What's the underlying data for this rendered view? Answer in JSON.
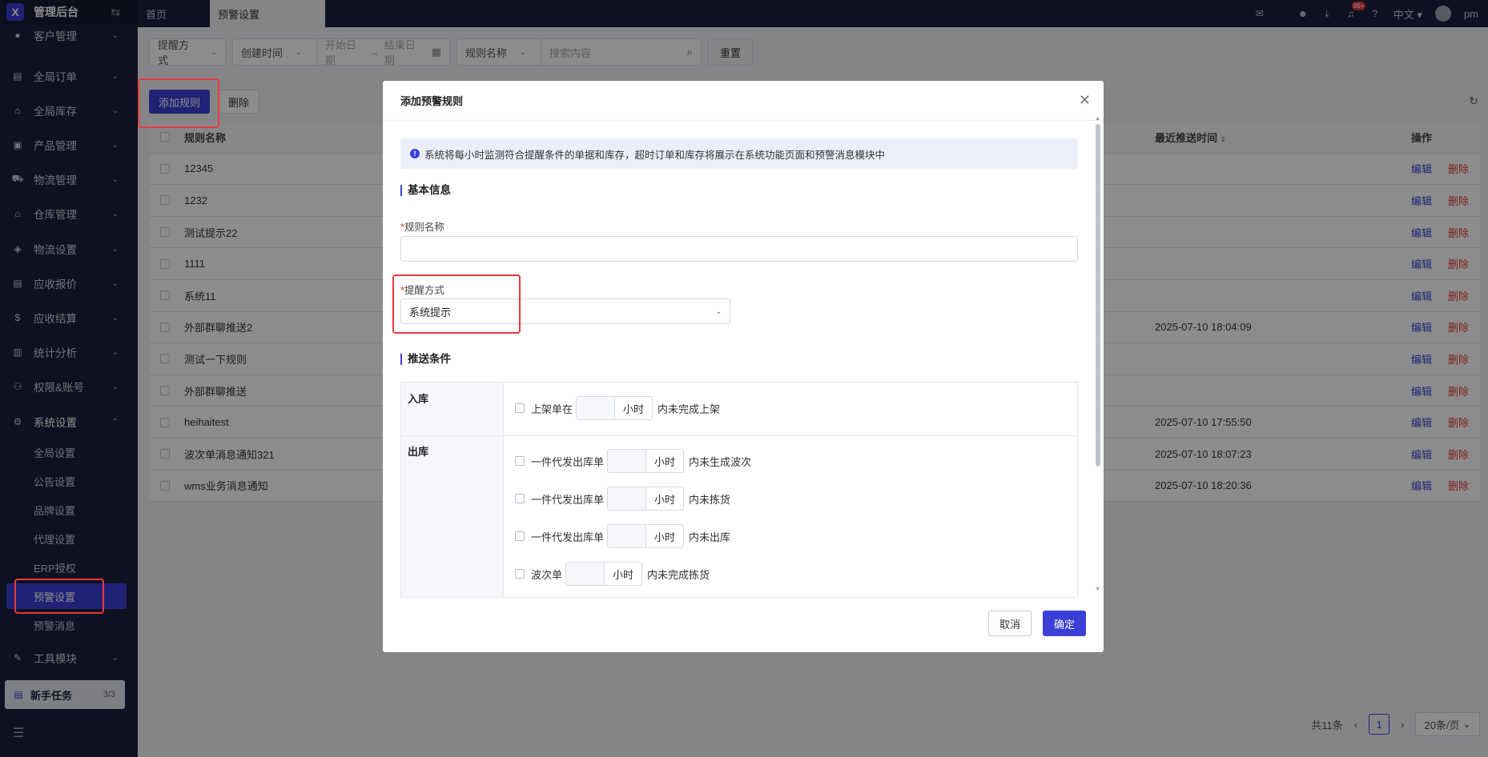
{
  "app": {
    "title": "管理后台",
    "logo": "X"
  },
  "topbar": {
    "tabs": [
      {
        "label": "首页"
      },
      {
        "label": "预警设置"
      }
    ],
    "notification_badge": "99+",
    "language": "中文",
    "user": "pm"
  },
  "sidebar": {
    "items": [
      {
        "label": "客户管理",
        "icon": "user-icon"
      },
      {
        "label": "全局订单",
        "icon": "order-icon"
      },
      {
        "label": "全局库存",
        "icon": "warehouse-icon"
      },
      {
        "label": "产品管理",
        "icon": "product-icon"
      },
      {
        "label": "物流管理",
        "icon": "truck-icon"
      },
      {
        "label": "仓库管理",
        "icon": "building-icon"
      },
      {
        "label": "物流设置",
        "icon": "package-icon"
      },
      {
        "label": "应收报价",
        "icon": "quote-icon"
      },
      {
        "label": "应收结算",
        "icon": "money-icon"
      },
      {
        "label": "统计分析",
        "icon": "chart-icon"
      },
      {
        "label": "权限&账号",
        "icon": "org-icon"
      },
      {
        "label": "系统设置",
        "icon": "gear-icon"
      }
    ],
    "sub_items": [
      {
        "label": "全局设置"
      },
      {
        "label": "公告设置"
      },
      {
        "label": "品牌设置"
      },
      {
        "label": "代理设置"
      },
      {
        "label": "ERP授权"
      },
      {
        "label": "预警设置"
      },
      {
        "label": "预警消息"
      }
    ],
    "tools": {
      "label": "工具模块"
    },
    "newtask": {
      "label": "新手任务",
      "count": "3/3"
    }
  },
  "filters": {
    "remind": "提醒方式",
    "created": "创建时间",
    "start": "开始日期",
    "arrow": "→",
    "end": "结束日期",
    "name": "规则名称",
    "search_placeholder": "搜索内容",
    "reset": "重置"
  },
  "toolbar": {
    "add": "添加规则",
    "delete": "删除"
  },
  "table": {
    "headers": {
      "name": "规则名称",
      "time": "最近推送时间",
      "op": "操作"
    },
    "edit": "编辑",
    "del": "删除",
    "rows": [
      {
        "name": "12345",
        "time": ""
      },
      {
        "name": "1232",
        "time": ""
      },
      {
        "name": "测试提示22",
        "time": ""
      },
      {
        "name": "1111",
        "time": ""
      },
      {
        "name": "系统11",
        "time": ""
      },
      {
        "name": "外部群聊推送2",
        "time": "2025-07-10 18:04:09"
      },
      {
        "name": "测试一下规则",
        "time": ""
      },
      {
        "name": "外部群聊推送",
        "time": ""
      },
      {
        "name": "heihaitest",
        "time": "2025-07-10 17:55:50"
      },
      {
        "name": "波次单消息通知321",
        "time": "2025-07-10 18:07:23"
      },
      {
        "name": "wms业务消息通知",
        "time": "2025-07-10 18:20:36"
      }
    ]
  },
  "pager": {
    "total": "共11条",
    "page": "1",
    "size": "20条/页"
  },
  "modal": {
    "title": "添加预警规则",
    "notice": "系统将每小时监测符合提醒条件的单据和库存，超时订单和库存将展示在系统功能页面和预警消息模块中",
    "section_basic": "基本信息",
    "name_label": "规则名称",
    "name_value": "",
    "remind_label": "提醒方式",
    "remind_value": "系统提示",
    "section_push": "推送条件",
    "inbound_label": "入库",
    "outbound_label": "出库",
    "unit": "小时",
    "inbound_rows": [
      {
        "prefix": "上架单在",
        "suffix": "内未完成上架"
      }
    ],
    "outbound_rows": [
      {
        "prefix": "一件代发出库单",
        "suffix": "内未生成波次"
      },
      {
        "prefix": "一件代发出库单",
        "suffix": "内未拣货"
      },
      {
        "prefix": "一件代发出库单",
        "suffix": "内未出库"
      },
      {
        "prefix": "波次单",
        "suffix": "内未完成拣货"
      }
    ],
    "cancel": "取消",
    "ok": "确定"
  }
}
